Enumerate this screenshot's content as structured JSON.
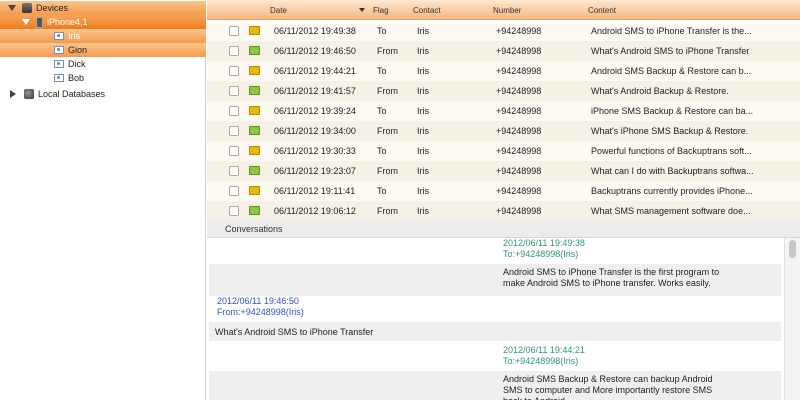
{
  "sidebar": {
    "devices_label": "Devices",
    "device_label": "iPhone4,1",
    "contacts": [
      "Iris",
      "Gion",
      "Dick",
      "Bob"
    ],
    "local_databases_label": "Local Databases"
  },
  "table": {
    "headers": [
      "Date",
      "Flag",
      "Contact",
      "Number",
      "Content"
    ],
    "sorted_by": "Date",
    "rows": [
      {
        "icon": "sent",
        "date": "06/11/2012 19:49:38",
        "flag": "To",
        "contact": "Iris",
        "number": "+94248998",
        "content": "Android SMS to iPhone Transfer is the..."
      },
      {
        "icon": "received",
        "date": "06/11/2012 19:46:50",
        "flag": "From",
        "contact": "Iris",
        "number": "+94248998",
        "content": "What's Android SMS to iPhone Transfer"
      },
      {
        "icon": "sent",
        "date": "06/11/2012 19:44:21",
        "flag": "To",
        "contact": "Iris",
        "number": "+94248998",
        "content": "Android SMS Backup & Restore can b..."
      },
      {
        "icon": "received",
        "date": "06/11/2012 19:41:57",
        "flag": "From",
        "contact": "Iris",
        "number": "+94248998",
        "content": "What's Android Backup & Restore."
      },
      {
        "icon": "sent",
        "date": "06/11/2012 19:39:24",
        "flag": "To",
        "contact": "Iris",
        "number": "+94248998",
        "content": "iPhone SMS Backup & Restore can ba..."
      },
      {
        "icon": "received",
        "date": "06/11/2012 19:34:00",
        "flag": "From",
        "contact": "Iris",
        "number": "+94248998",
        "content": "What's iPhone SMS Backup & Restore."
      },
      {
        "icon": "sent",
        "date": "06/11/2012 19:30:33",
        "flag": "To",
        "contact": "Iris",
        "number": "+94248998",
        "content": "Powerful functions of Backuptrans soft..."
      },
      {
        "icon": "received",
        "date": "06/11/2012 19:23:07",
        "flag": "From",
        "contact": "Iris",
        "number": "+94248998",
        "content": "What can I do with Backuptrans softwa..."
      },
      {
        "icon": "sent",
        "date": "06/11/2012 19:11:41",
        "flag": "To",
        "contact": "Iris",
        "number": "+94248998",
        "content": "Backuptrans currently provides iPhone..."
      },
      {
        "icon": "received",
        "date": "06/11/2012 19:06:12",
        "flag": "From",
        "contact": "Iris",
        "number": "+94248998",
        "content": "What SMS management software doe..."
      }
    ]
  },
  "conversations": {
    "label": "Conversations",
    "messages": [
      {
        "direction": "to",
        "time": "2012/06/11 19:49:38",
        "party": "To:+94248998(Iris)",
        "lines": [
          "Android SMS to iPhone Transfer is the first program to",
          "make Android SMS to iPhone transfer. Works easily."
        ]
      },
      {
        "direction": "from",
        "time": "2012/06/11 19:46:50",
        "party": "From:+94248998(Iris)",
        "lines": [
          "What's Android SMS to iPhone Transfer"
        ]
      },
      {
        "direction": "to",
        "time": "2012/06/11 19:44:21",
        "party": "To:+94248998(Iris)",
        "lines": [
          "Android SMS Backup & Restore can backup Android",
          "SMS to computer and More importantly restore SMS",
          "back to Android"
        ]
      }
    ]
  },
  "colors": {
    "accent_orange": "#f07c1c",
    "sent_to_text": "#2e9a6a",
    "received_from_text": "#3050d0"
  }
}
